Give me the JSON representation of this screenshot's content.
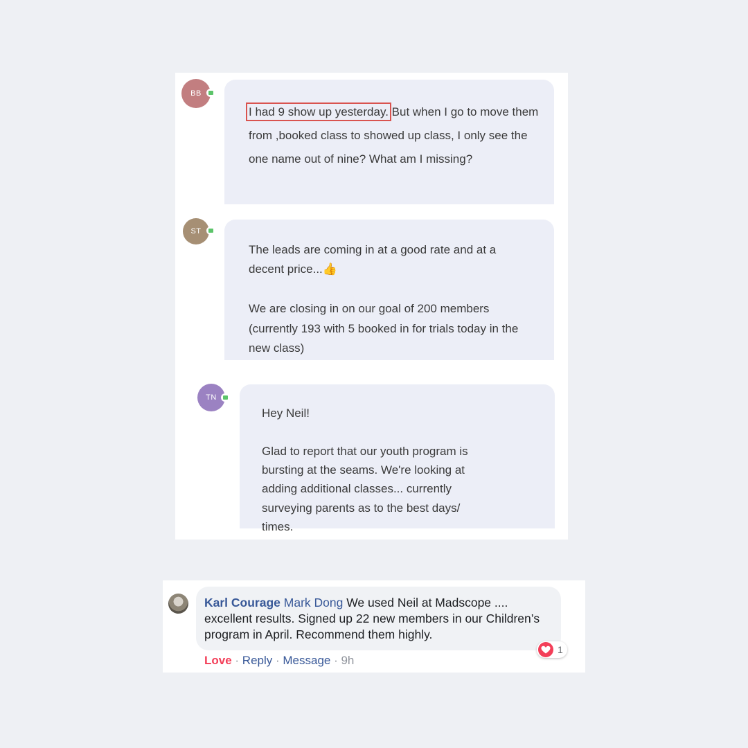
{
  "messages": [
    {
      "initials": "BB",
      "avatar_color": "#c27e80",
      "highlight": "I had 9 show up yesterday.",
      "text": " But when I go to move them from ,booked class to  showed up class, I only see the one name out of nine? What am I missing?"
    },
    {
      "initials": "ST",
      "avatar_color": "#a68f74",
      "para1": "The leads are coming in at a good rate and at a decent price...",
      "emoji": "👍",
      "para2": "We are closing in on our goal of 200 members (currently 193 with 5 booked in for trials today in the new class)"
    },
    {
      "initials": "TN",
      "avatar_color": "#9b82c2",
      "para1": "Hey Neil!",
      "para2": "Glad to report that our youth program is bursting at the seams. We're looking at adding additional classes... currently surveying parents as to the best days/ times."
    }
  ],
  "comment": {
    "author": "Karl Courage",
    "mention": "Mark Dong",
    "text": " We used Neil at Madscope .... excellent results. Signed up 22 new members in our Children’s program in April. Recommend them highly.",
    "actions": {
      "love": "Love",
      "reply": "Reply",
      "message": "Message",
      "time": "9h",
      "separator": " · "
    },
    "reaction": {
      "icon": "heart-icon",
      "count": "1"
    }
  },
  "colors": {
    "love": "#f33e58",
    "link": "#385898",
    "highlight_border": "#d9534f",
    "online_badge": "#5cc46a"
  }
}
